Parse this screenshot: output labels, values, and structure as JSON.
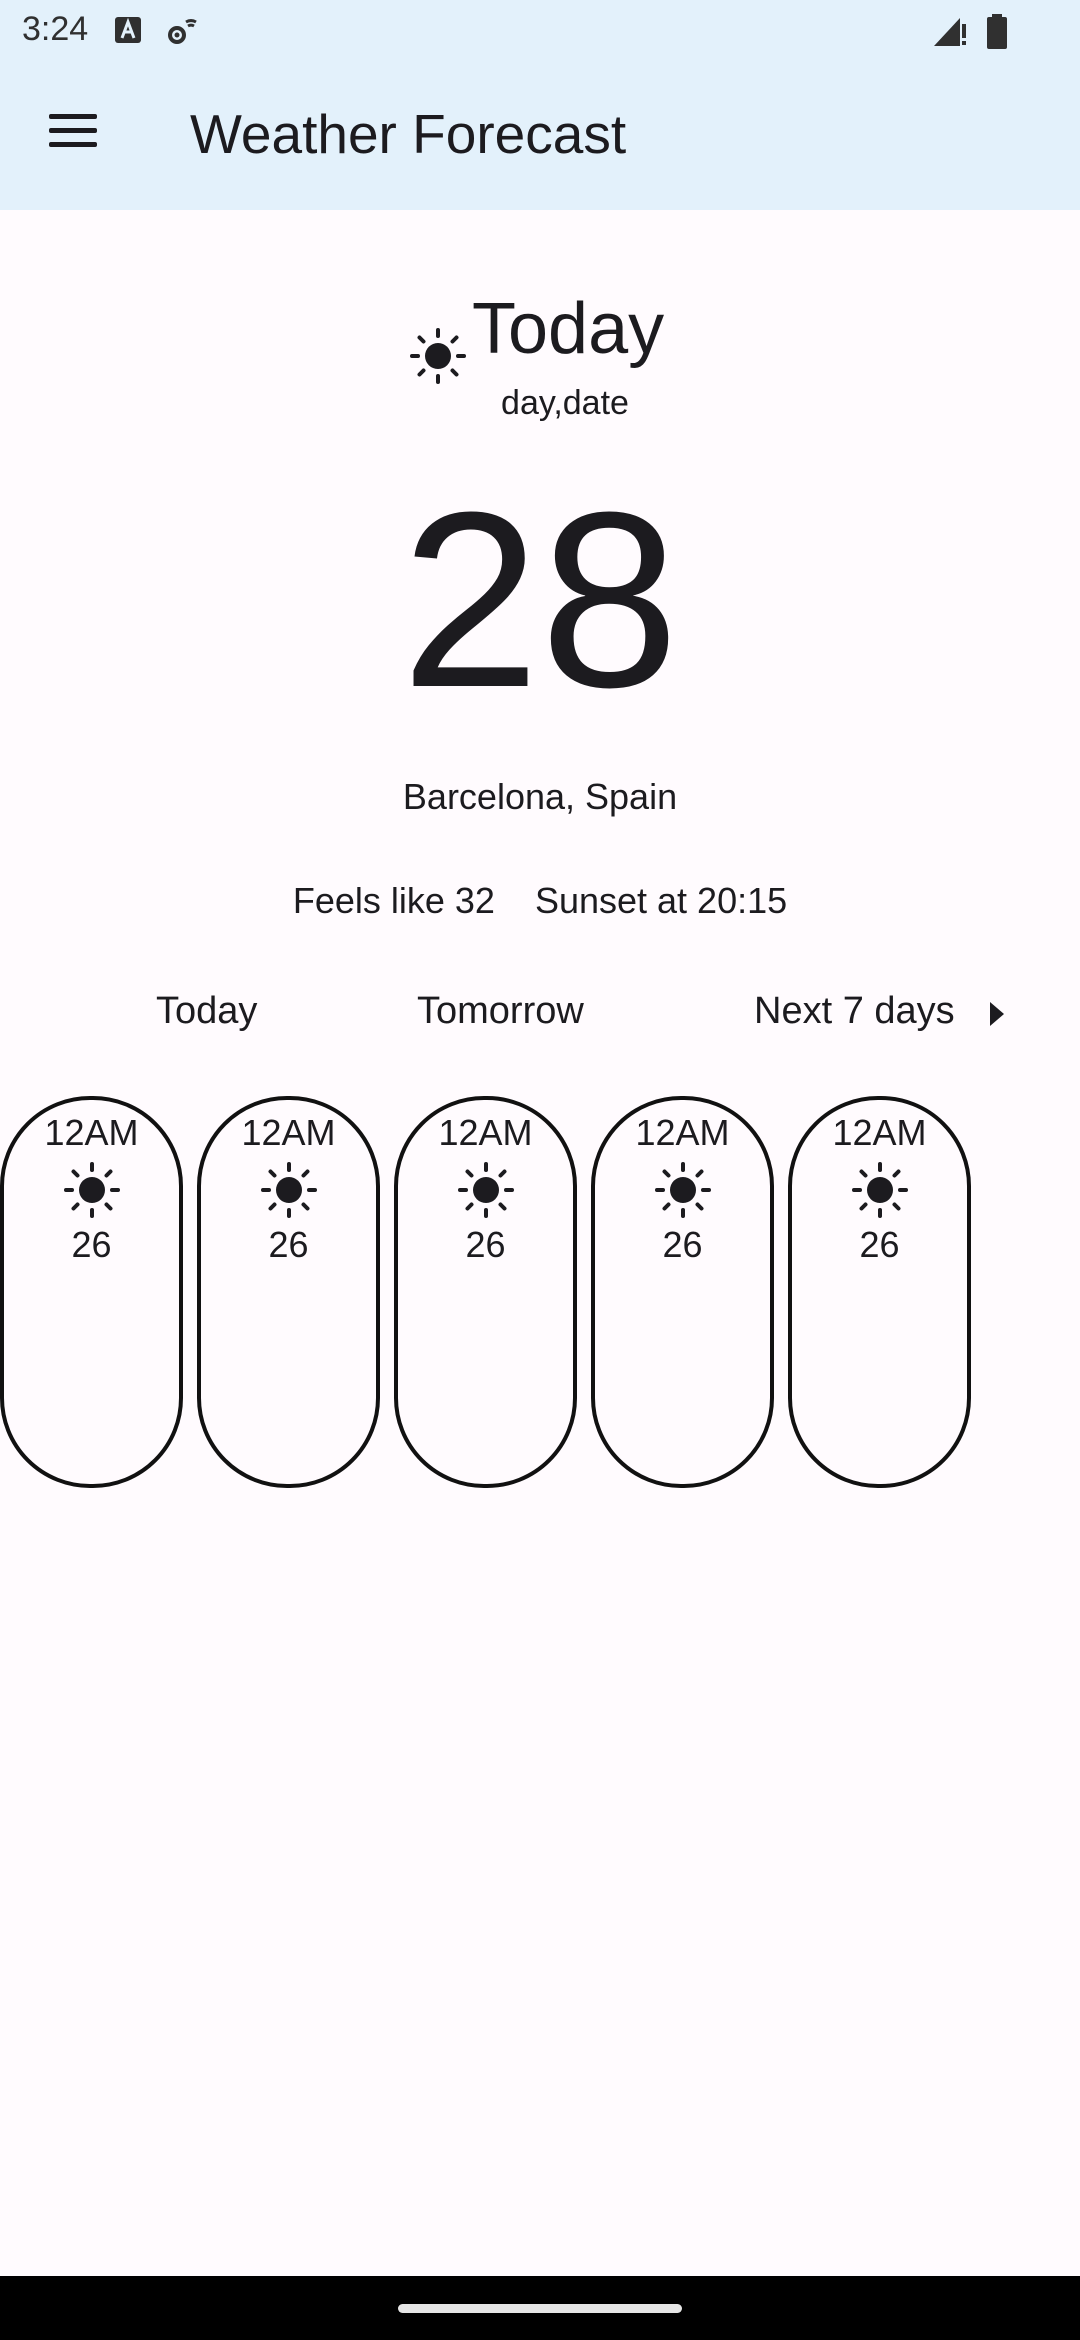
{
  "status_bar": {
    "time": "3:24",
    "icons": [
      "font-a-icon",
      "wifi-settings-icon",
      "signal-icon",
      "battery-icon"
    ]
  },
  "app_bar": {
    "menu_icon": "menu-icon",
    "title": "Weather Forecast"
  },
  "header": {
    "icon": "sun-icon",
    "title": "Today",
    "subtitle": "day,date"
  },
  "current": {
    "temperature": "28",
    "location": "Barcelona, Spain",
    "feels_like": "Feels like 32",
    "sunset": "Sunset at 20:15"
  },
  "tabs": [
    {
      "label": "Today"
    },
    {
      "label": "Tomorrow"
    },
    {
      "label": "Next 7 days",
      "icon": "arrow-right-icon"
    }
  ],
  "hourly": [
    {
      "time": "12AM",
      "icon": "sun-icon",
      "temp": "26"
    },
    {
      "time": "12AM",
      "icon": "sun-icon",
      "temp": "26"
    },
    {
      "time": "12AM",
      "icon": "sun-icon",
      "temp": "26"
    },
    {
      "time": "12AM",
      "icon": "sun-icon",
      "temp": "26"
    },
    {
      "time": "12AM",
      "icon": "sun-icon",
      "temp": "26"
    }
  ],
  "colors": {
    "app_bar_bg": "#e3f1fb",
    "page_bg": "#fffbfe",
    "text": "#1c1b1f",
    "card_border": "#111111"
  }
}
